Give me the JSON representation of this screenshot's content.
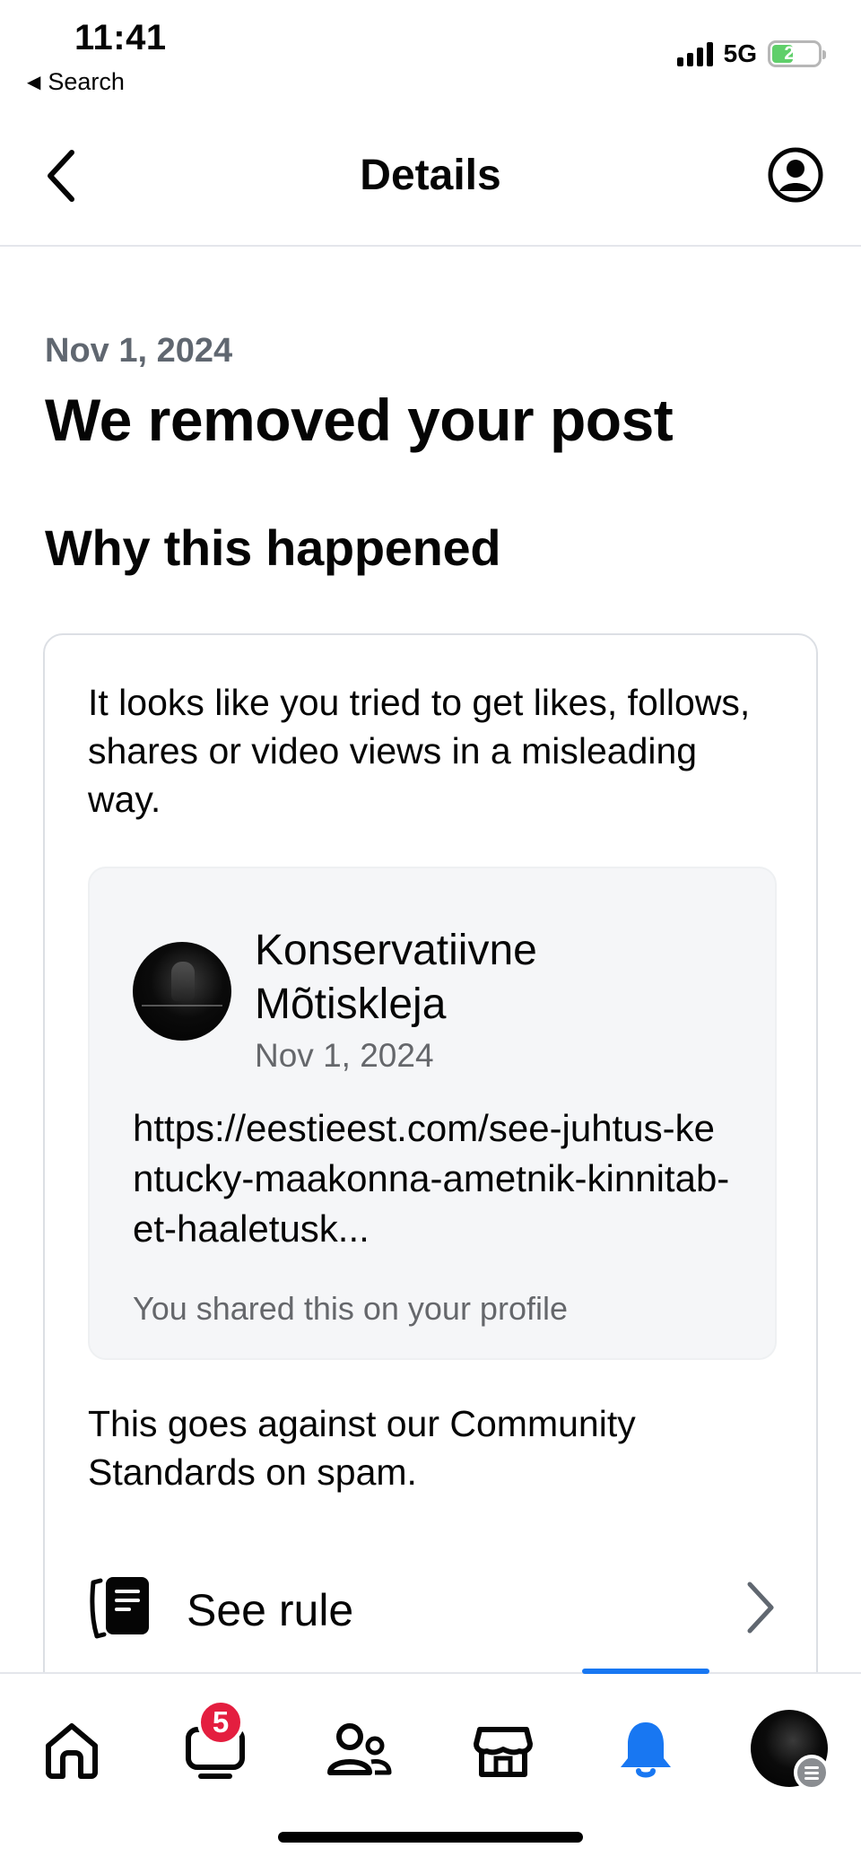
{
  "status_bar": {
    "time": "11:41",
    "back_app": "Search",
    "network": "5G",
    "battery": "21"
  },
  "header": {
    "title": "Details"
  },
  "content": {
    "date": "Nov 1, 2024",
    "headline": "We removed your post",
    "subheading": "Why this happened",
    "reason": "It looks like you tried to get likes, follows, shares or video views in a misleading way.",
    "post": {
      "author": "Konservatiivne Mõtiskleja",
      "date": "Nov 1, 2024",
      "link": "https://eestieest.com/see-juhtus-kentucky-maakonna-ametnik-kinnitab-et-haaletusk...",
      "shared_note": "You shared this on your profile"
    },
    "against": "This goes against our Community Standards on spam.",
    "see_rule": "See rule"
  },
  "tabbar": {
    "video_badge": "5",
    "active_tab": "notifications"
  },
  "colors": {
    "accent": "#1877f2",
    "badge": "#e41e3f",
    "muted_text": "#65676b"
  }
}
